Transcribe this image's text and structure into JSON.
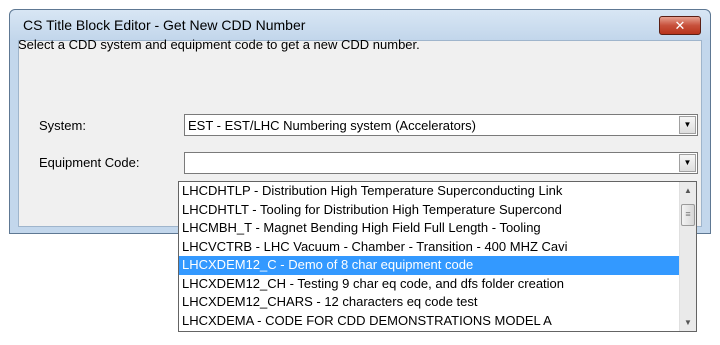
{
  "window": {
    "title": "CS Title Block Editor - Get New CDD Number",
    "close_label": "✕"
  },
  "instruction": "Select a CDD system and equipment code to get a new CDD number.",
  "system": {
    "label": "System:",
    "value": "EST - EST/LHC Numbering system (Accelerators)"
  },
  "equipment": {
    "label": "Equipment Code:",
    "value": ""
  },
  "icons": {
    "dropdown_arrow": "▼",
    "scroll_up": "▲",
    "scroll_down": "▼",
    "thumb_grip": "≡"
  },
  "dropdown_items": [
    {
      "label": "LHCDHTLP - Distribution High Temperature Superconducting Link",
      "selected": false
    },
    {
      "label": "LHCDHTLT - Tooling for Distribution High Temperature Supercond",
      "selected": false
    },
    {
      "label": "LHCMBH_T - Magnet Bending High Field Full Length - Tooling",
      "selected": false
    },
    {
      "label": "LHCVCTRB - LHC Vacuum - Chamber - Transition - 400 MHZ Cavi",
      "selected": false
    },
    {
      "label": "LHCXDEM12_C - Demo of 8 char equipment code",
      "selected": true
    },
    {
      "label": "LHCXDEM12_CH - Testing 9 char eq code, and dfs folder creation",
      "selected": false
    },
    {
      "label": "LHCXDEM12_CHARS - 12 characters eq code test",
      "selected": false
    },
    {
      "label": "LHCXDEMA - CODE FOR CDD DEMONSTRATIONS MODEL A",
      "selected": false
    }
  ],
  "colors": {
    "selection": "#3399ff",
    "titlebar": "#c3d7ec",
    "close_button": "#c7503b",
    "dialog_background": "#f0f0f0"
  }
}
